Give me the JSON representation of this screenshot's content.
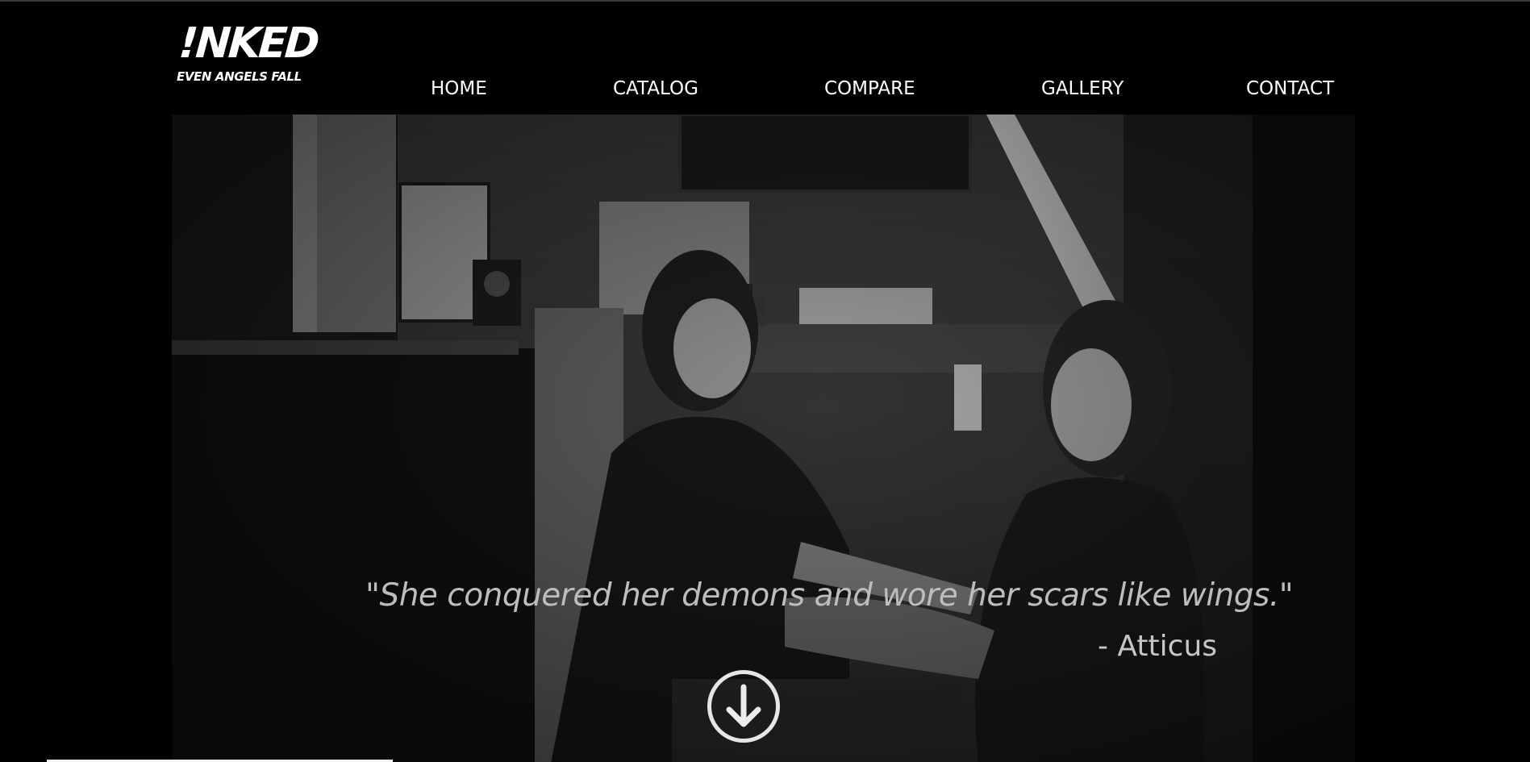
{
  "logo": {
    "main_text": "!NKED",
    "tagline": "EVEN ANGELS FALL"
  },
  "nav": {
    "items": [
      {
        "label": "HOME"
      },
      {
        "label": "CATALOG"
      },
      {
        "label": "COMPARE"
      },
      {
        "label": "GALLERY"
      },
      {
        "label": "CONTACT"
      }
    ]
  },
  "hero": {
    "quote": "\"She conquered her demons and wore her scars like wings.\"",
    "attribution": "- Atticus",
    "scroll_icon": "arrow-down-circle-icon"
  },
  "colors": {
    "background": "#000000",
    "text": "#ffffff",
    "quote_text": "#bdbdbd"
  }
}
